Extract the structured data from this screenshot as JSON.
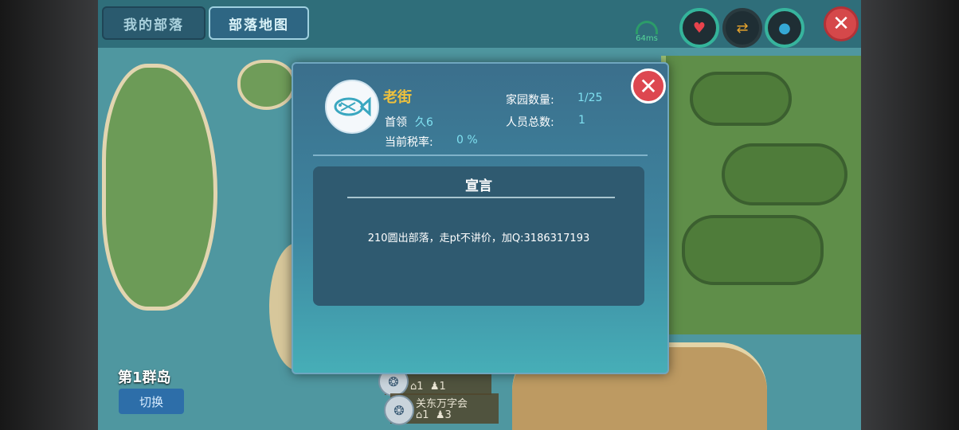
{
  "tabs": {
    "my_tribe": "我的部落",
    "tribe_map": "部落地图"
  },
  "status": {
    "ping": "64ms"
  },
  "top_icons": [
    "heart-icon",
    "swap-icon",
    "water-drop-icon"
  ],
  "island": {
    "name": "第1群岛",
    "switch_label": "切换"
  },
  "map_tribes": [
    {
      "name": "",
      "homes": "1",
      "members": "1"
    },
    {
      "name": "关东万字会",
      "homes": "1",
      "members": "3"
    }
  ],
  "modal": {
    "tribe_name": "老街",
    "leader_label": "首领",
    "leader_value": "久6",
    "tax_label": "当前税率:",
    "tax_value": "0 %",
    "homes_label": "家园数量:",
    "homes_value": "1/25",
    "members_label": "人员总数:",
    "members_value": "1",
    "declaration_title": "宣言",
    "declaration_text": "210圆出部落，走pt不讲价，加Q:3186317193",
    "emblem_icon": "fish-emblem-icon"
  },
  "colors": {
    "accent_gold": "#f0c23c",
    "value_cyan": "#7fe0f0",
    "close_red": "#dd4750"
  }
}
